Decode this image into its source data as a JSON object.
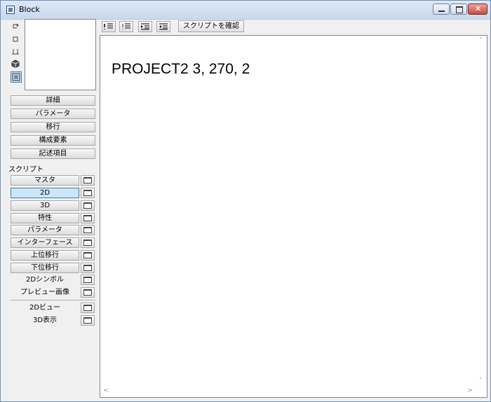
{
  "window": {
    "title": "Block"
  },
  "toolbar": {
    "check_script_label": "スクリプトを確認"
  },
  "view_icons": [
    "rotate-icon",
    "square-view-icon",
    "elevation-view-icon",
    "3d-cube-icon",
    "list-view-icon"
  ],
  "panel_buttons": [
    "詳細",
    "パラメータ",
    "移行",
    "構成要素",
    "記述項目"
  ],
  "scripts_label": "スクリプト",
  "scripts": [
    {
      "label": "マスタ"
    },
    {
      "label": "2D",
      "selected": true
    },
    {
      "label": "3D"
    },
    {
      "label": "特性"
    },
    {
      "label": "パラメータ"
    },
    {
      "label": "インターフェース"
    },
    {
      "label": "上位移行"
    },
    {
      "label": "下位移行"
    },
    {
      "label": "2Dシンボル"
    },
    {
      "label": "プレビュー画像"
    }
  ],
  "views": [
    {
      "label": "2Dビュー"
    },
    {
      "label": "3D表示"
    }
  ],
  "editor": {
    "content": "PROJECT2 3, 270, 2"
  }
}
